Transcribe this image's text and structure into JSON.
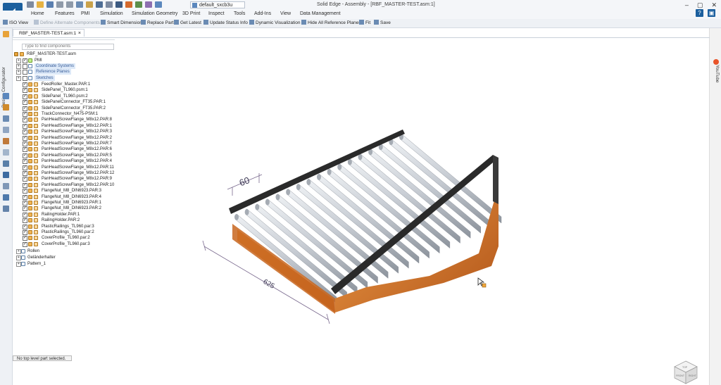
{
  "window": {
    "title": "Solid Edge - Assembly - [RBF_MASTER-TEST.asm:1]",
    "theme_dropdown": "default_sxcb3u",
    "controls": [
      "–",
      "▢",
      "✕"
    ]
  },
  "ribbon_tabs": [
    "Home",
    "Features",
    "PMI",
    "Simulation",
    "Simulation Geometry",
    "3D Print",
    "Inspect",
    "Tools",
    "Add-Ins",
    "View",
    "Data Management"
  ],
  "command_bar": [
    "ISO View",
    "Define Alternate Components",
    "Smart Dimension",
    "Replace Part",
    "Get Latest",
    "Update Status Info",
    "Dynamic Visualization",
    "Hide All Reference Planes",
    "Fit",
    "Save"
  ],
  "side_panel": {
    "left_label": "Design Configurator",
    "right_label": "YouTube"
  },
  "document_tab": {
    "label": "RBF_MASTER-TEST.asm:1",
    "close": "×"
  },
  "search": {
    "placeholder": "Type to find components"
  },
  "tree": {
    "root": "RBF_MASTER-TEST.asm",
    "groups": [
      "PMI",
      "Coordinate Systems",
      "Reference Planes",
      "Sketches"
    ],
    "parts": [
      "FeedRoller_Master.PAR:1",
      "SidePanel_TL960.psm:1",
      "SidePanel_TL960.psm:2",
      "SidePanelConnector_FT35.PAR:1",
      "SidePanelConnector_FT35.PAR:2",
      "TrackConnector_N475-PSM:1",
      "PanHeadScrewFlange_M8x12.PAR:8",
      "PanHeadScrewFlange_M8x12.PAR:1",
      "PanHeadScrewFlange_M8x12.PAR:3",
      "PanHeadScrewFlange_M8x12.PAR:2",
      "PanHeadScrewFlange_M8x12.PAR:7",
      "PanHeadScrewFlange_M8x12.PAR:6",
      "PanHeadScrewFlange_M8x12.PAR:5",
      "PanHeadScrewFlange_M8x12.PAR:4",
      "PanHeadScrewFlange_M8x12.PAR:11",
      "PanHeadScrewFlange_M8x12.PAR:12",
      "PanHeadScrewFlange_M8x12.PAR:9",
      "PanHeadScrewFlange_M8x12.PAR:10",
      "FlangeNut_M8_DIN6923.PAR:3",
      "FlangeNut_M8_DIN6923.PAR:4",
      "FlangeNut_M8_DIN6923.PAR:1",
      "FlangeNut_M8_DIN6923.PAR:2",
      "RailingHolder.PAR:1",
      "RailingHolder.PAR:2",
      "PlasticRailings_TL960.par:3",
      "PlasticRailings_TL960.par:2",
      "CoverProfile_TL960.par:2",
      "CoverProfile_TL960.par:3"
    ],
    "patterns": [
      "Rollen",
      "Geländerhalter",
      "Pattern_1"
    ]
  },
  "dimensions": {
    "pitch": "60",
    "width": "625"
  },
  "status": {
    "message": "No top level part selected."
  },
  "view_cube": {
    "top": "TOP",
    "front": "FRONT",
    "right": "RIGHT"
  },
  "colors": {
    "accent": "#1b5f9e",
    "orange": "#d9701c",
    "roller": "#c8ccd2",
    "cover": "#2a2a2a"
  }
}
